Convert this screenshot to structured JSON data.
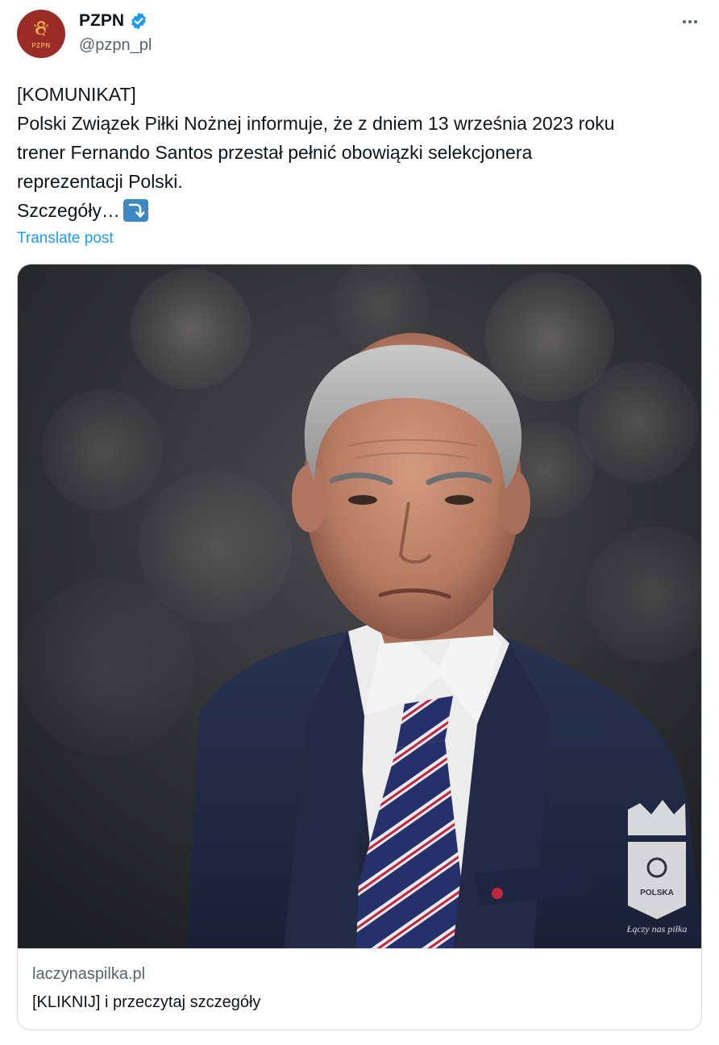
{
  "author": {
    "display_name": "PZPN",
    "handle": "@pzpn_pl",
    "avatar_text": "PZPN",
    "verified": true,
    "brand_color": "#9b2b26",
    "verified_color": "#1d9bf0"
  },
  "tweet": {
    "lines": [
      "[KOMUNIKAT]",
      "Polski Związek Piłki Nożnej informuje, że z dniem 13 września 2023 roku",
      "trener Fernando Santos przestał pełnić obowiązki selekcjonera",
      "reprezentacji Polski.",
      "Szczegóły…"
    ],
    "trailing_emoji": "right-arrow-curving-down-icon",
    "translate_label": "Translate post"
  },
  "link_card": {
    "image_alt_icon": "photo-coach-portrait",
    "logo_text": "POLSKA",
    "logo_tagline": "Łączy nas piłka",
    "domain": "laczynaspilka.pl",
    "title": "[KLIKNIJ] i przeczytaj szczegóły"
  }
}
